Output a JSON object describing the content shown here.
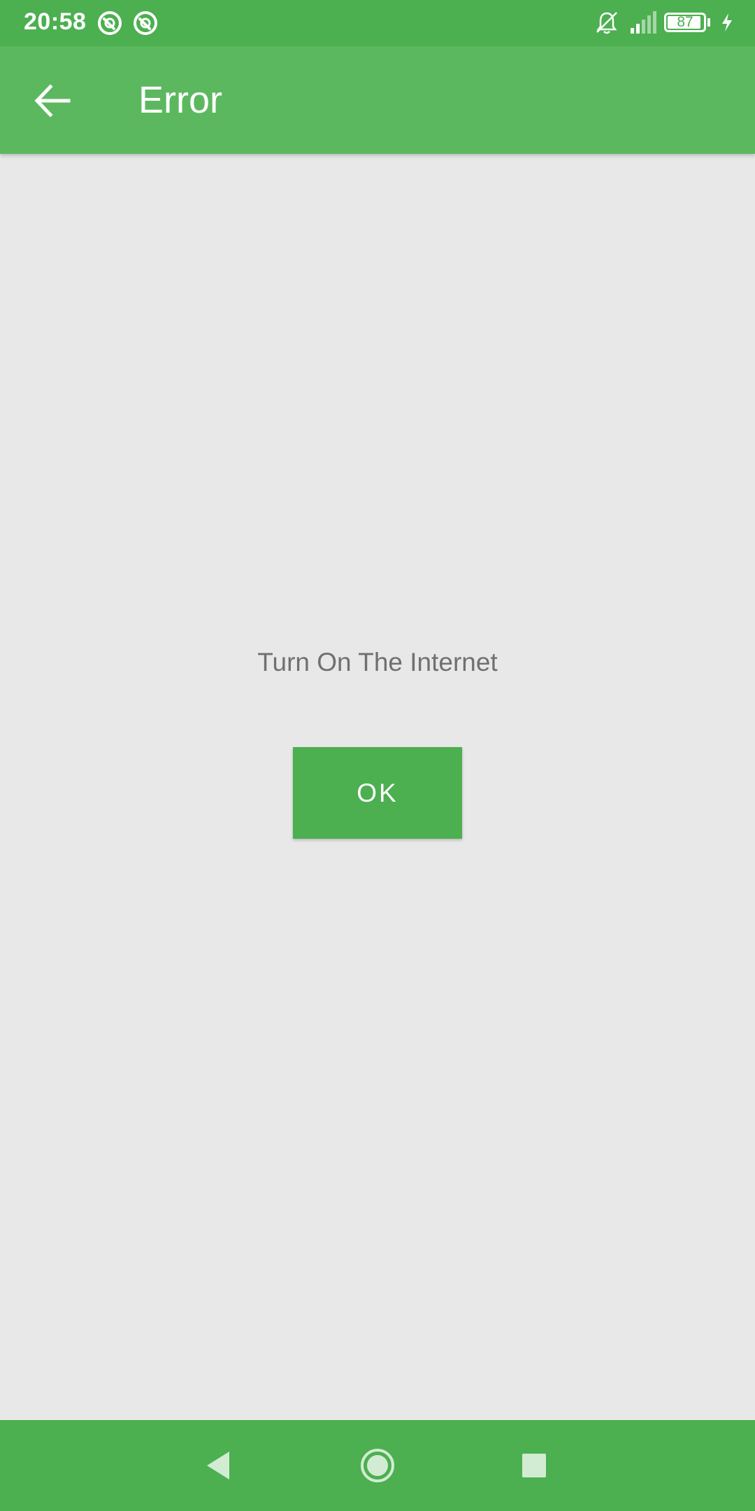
{
  "status_bar": {
    "time": "20:58",
    "app_icons": [
      "notification-app-icon",
      "notification-app-icon"
    ],
    "battery_level": "87",
    "icons": [
      "bell-off-icon",
      "signal-icon",
      "battery-icon",
      "charging-bolt-icon"
    ]
  },
  "app_bar": {
    "title": "Error",
    "back_icon": "arrow-left-icon"
  },
  "content": {
    "message": "Turn On The Internet",
    "ok_label": "OK"
  },
  "nav_bar": {
    "icons": [
      "nav-back-icon",
      "nav-home-icon",
      "nav-recents-icon"
    ]
  },
  "colors": {
    "status_bar": "#4caf50",
    "app_bar": "#5cb85f",
    "background": "#e8e8e8",
    "button": "#4caf50",
    "message_text": "#707070"
  }
}
